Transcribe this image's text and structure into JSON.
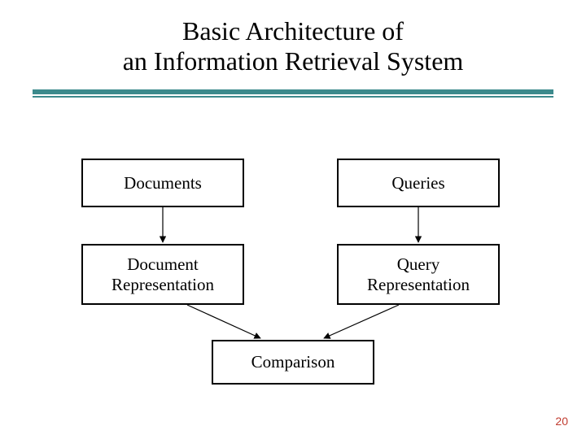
{
  "title_line1": "Basic Architecture of",
  "title_line2": "an Information Retrieval System",
  "nodes": {
    "documents": "Documents",
    "queries": "Queries",
    "doc_rep_line1": "Document",
    "doc_rep_line2": "Representation",
    "qry_rep_line1": "Query",
    "qry_rep_line2": "Representation",
    "comparison": "Comparison"
  },
  "colors": {
    "rule": "#3c8a8c",
    "page_number": "#c03b2f"
  },
  "page_number": "20"
}
